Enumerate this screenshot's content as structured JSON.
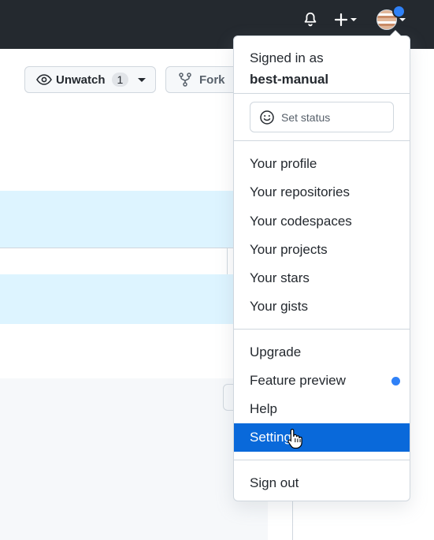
{
  "header": {
    "icons": [
      "bell-icon",
      "plus-icon",
      "avatar"
    ],
    "notification_color": "#2f81f7"
  },
  "repo_actions": {
    "unwatch_label": "Unwatch",
    "unwatch_count": "1",
    "fork_label": "Fork"
  },
  "menu": {
    "signed_in_label": "Signed in as",
    "username": "best-manual",
    "set_status_label": "Set status",
    "group1": [
      "Your profile",
      "Your repositories",
      "Your codespaces",
      "Your projects",
      "Your stars",
      "Your gists"
    ],
    "group2": [
      "Upgrade",
      "Feature preview",
      "Help",
      "Settings"
    ],
    "sign_out_label": "Sign out",
    "active_item": "Settings",
    "active_color": "#0969da"
  }
}
